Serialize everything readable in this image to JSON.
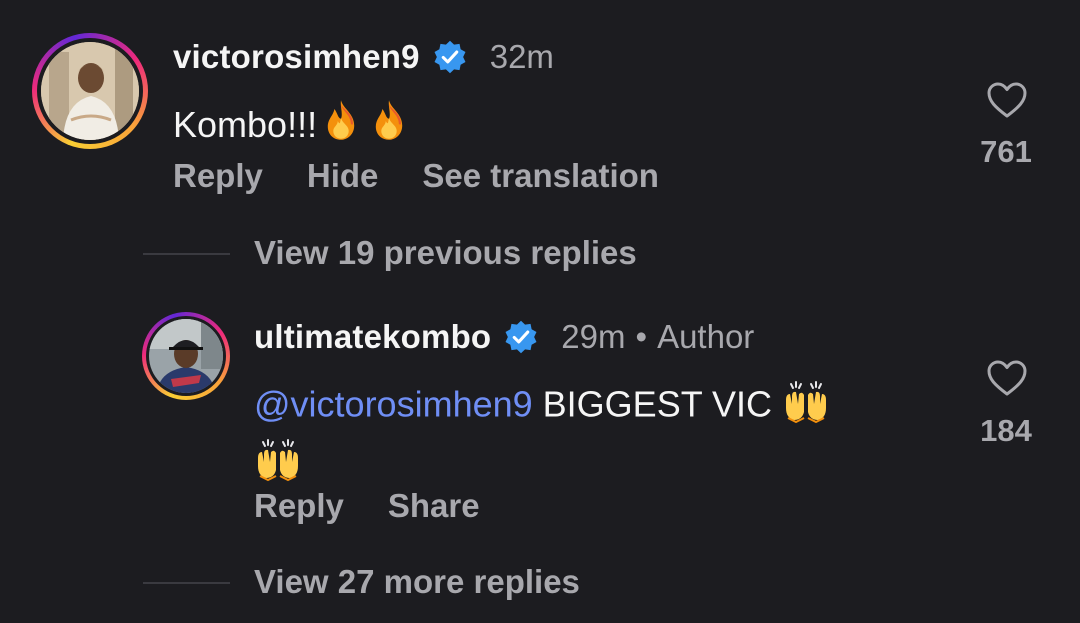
{
  "comment": {
    "username": "victorosimhen9",
    "verified_icon": "verified-badge-icon",
    "time": "32m",
    "text": "Kombo!!!",
    "emojis": [
      "fire",
      "fire"
    ],
    "likes": "761",
    "actions": {
      "reply": "Reply",
      "hide": "Hide",
      "translate": "See translation"
    }
  },
  "view_previous": "View 19 previous replies",
  "reply": {
    "username": "ultimatekombo",
    "verified_icon": "verified-badge-icon",
    "time": "29m",
    "separator": "•",
    "role": "Author",
    "mention": "@victorosimhen9",
    "text": " BIGGEST VIC ",
    "emojis": [
      "raising-hands",
      "raising-hands"
    ],
    "likes": "184",
    "actions": {
      "reply": "Reply",
      "share": "Share"
    }
  },
  "view_more": "View 27 more replies",
  "colors": {
    "background": "#1c1c20",
    "verified": "#3897f0",
    "mention": "#6f8ef5",
    "muted": "#a8a8ad"
  }
}
